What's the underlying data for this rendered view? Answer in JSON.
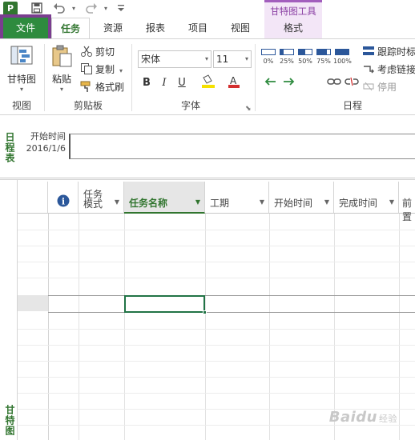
{
  "qat": {
    "app_letter": "P"
  },
  "context_group": {
    "title": "甘特图工具"
  },
  "tabs": [
    {
      "label": "文件"
    },
    {
      "label": "任务"
    },
    {
      "label": "资源"
    },
    {
      "label": "报表"
    },
    {
      "label": "项目"
    },
    {
      "label": "视图"
    },
    {
      "label": "格式"
    }
  ],
  "ribbon": {
    "view": {
      "button": "甘特图",
      "label": "视图"
    },
    "clipboard": {
      "paste": "粘贴",
      "cut": "剪切",
      "copy": "复制",
      "painter": "格式刷",
      "label": "剪贴板"
    },
    "font": {
      "name": "宋体",
      "size": "11",
      "bold": "B",
      "italic": "I",
      "underline": "U",
      "label": "字体"
    },
    "schedule": {
      "percents": [
        "0%",
        "25%",
        "50%",
        "75%",
        "100%"
      ],
      "track": "跟踪时标",
      "respect": "考虑链接",
      "disable": "停用",
      "label": "日程"
    },
    "colors": {
      "accent": "#31752f",
      "file_tab": "#2e8b3e",
      "context": "#a25ebd"
    }
  },
  "timeline": {
    "side_label": "日程表",
    "start_label": "开始时间",
    "start_date": "2016/1/6"
  },
  "gantt": {
    "side_label": "甘特图",
    "columns": [
      {
        "label": "i",
        "kind": "info-icon"
      },
      {
        "label": "任务\n模式"
      },
      {
        "label": "任务名称"
      },
      {
        "label": "工期"
      },
      {
        "label": "开始时间"
      },
      {
        "label": "完成时间"
      },
      {
        "label": "前置"
      }
    ]
  },
  "watermark": {
    "brand": "Baidu",
    "suffix": "经验"
  }
}
